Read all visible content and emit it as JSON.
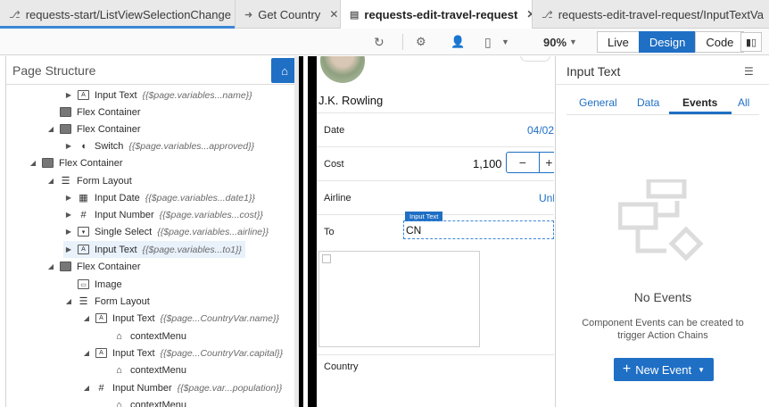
{
  "tabs": [
    {
      "label": "requests-start/ListViewSelectionChange",
      "icon": "branch-icon",
      "active": false
    },
    {
      "label": "Get Country",
      "icon": "arrow-right-icon",
      "active": false
    },
    {
      "label": "requests-edit-travel-request",
      "icon": "document-icon",
      "active": true
    },
    {
      "label": "requests-edit-travel-request/InputTextVa",
      "icon": "branch-icon",
      "active": false
    }
  ],
  "toolbar": {
    "zoom": "90%",
    "modes": {
      "live": "Live",
      "design": "Design",
      "code": "Code"
    },
    "active_mode": "Design"
  },
  "structure": {
    "title": "Page Structure",
    "nodes": [
      {
        "label": "Input Text",
        "expr": "{{$page.variables...name}}",
        "icon": "A",
        "level": 3
      },
      {
        "label": "Flex Container",
        "expr": "",
        "icon": "flex",
        "level": 2
      },
      {
        "label": "Flex Container",
        "expr": "",
        "icon": "flex",
        "level": 2
      },
      {
        "label": "Switch",
        "expr": "{{$page.variables...approved}}",
        "icon": "toggle",
        "level": 3
      },
      {
        "label": "Flex Container",
        "expr": "",
        "icon": "flex",
        "level": 1
      },
      {
        "label": "Form Layout",
        "expr": "",
        "icon": "list",
        "level": 2
      },
      {
        "label": "Input Date",
        "expr": "{{$page.variables...date1}}",
        "icon": "calendar",
        "level": 3
      },
      {
        "label": "Input Number",
        "expr": "{{$page.variables...cost}}",
        "icon": "#",
        "level": 3
      },
      {
        "label": "Single Select",
        "expr": "{{$page.variables...airline}}",
        "icon": "select",
        "level": 3
      },
      {
        "label": "Input Text",
        "expr": "{{$page.variables...to1}}",
        "icon": "A",
        "level": 3
      },
      {
        "label": "Flex Container",
        "expr": "",
        "icon": "flex",
        "level": 2
      },
      {
        "label": "Image",
        "expr": "",
        "icon": "image",
        "level": 3
      },
      {
        "label": "Form Layout",
        "expr": "",
        "icon": "list",
        "level": 3
      },
      {
        "label": "Input Text",
        "expr": "{{$page...CountryVar.name}}",
        "icon": "A",
        "level": 4
      },
      {
        "label": "contextMenu",
        "expr": "",
        "icon": "menu",
        "level": 5
      },
      {
        "label": "Input Text",
        "expr": "{{$page...CountryVar.capital}}",
        "icon": "A",
        "level": 4
      },
      {
        "label": "contextMenu",
        "expr": "",
        "icon": "menu",
        "level": 5
      },
      {
        "label": "Input Number",
        "expr": "{{$page.var...population}}",
        "icon": "#",
        "level": 4
      },
      {
        "label": "contextMenu",
        "expr": "",
        "icon": "menu",
        "level": 5
      }
    ]
  },
  "canvas": {
    "profile_name": "J.K. Rowling",
    "date_label": "Date",
    "date_value": "04/02",
    "cost_label": "Cost",
    "cost_value": "1,100",
    "stepper_minus": "−",
    "stepper_plus": "+",
    "airline_label": "Airline",
    "airline_value": "Unl",
    "to_label": "To",
    "to_badge": "Input Text",
    "to_value": "CN",
    "country_label": "Country"
  },
  "properties": {
    "title": "Input Text",
    "tabs": [
      "General",
      "Data",
      "Events",
      "All"
    ],
    "active_tab": "Events",
    "empty_title": "No Events",
    "empty_desc": "Component Events can be created to trigger Action Chains",
    "new_event_label": "New Event"
  },
  "colors": {
    "accent": "#1f6fc5",
    "tab_underline": "#3c86d6"
  }
}
